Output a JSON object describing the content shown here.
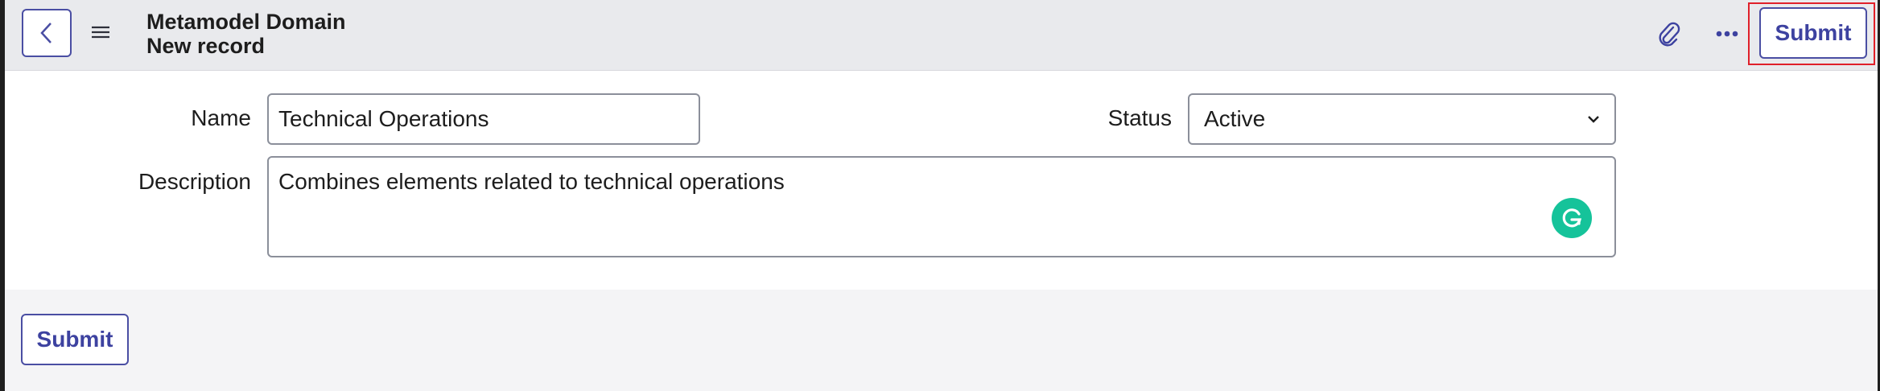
{
  "header": {
    "title": "Metamodel Domain",
    "subtitle": "New record",
    "submit_label": "Submit"
  },
  "icons": {
    "back": "chevron-left-icon",
    "menu": "hamburger-menu-icon",
    "attach": "paperclip-icon",
    "more": "more-horizontal-icon",
    "grammarly": "grammarly-icon"
  },
  "form": {
    "name_label": "Name",
    "name_value": "Technical Operations",
    "status_label": "Status",
    "status_value": "Active",
    "description_label": "Description",
    "description_value": "Combines elements related to technical operations"
  },
  "footer": {
    "submit_label": "Submit"
  },
  "colors": {
    "accent": "#3d42a0",
    "highlight": "#e0202a",
    "grammarly": "#15c39a"
  }
}
